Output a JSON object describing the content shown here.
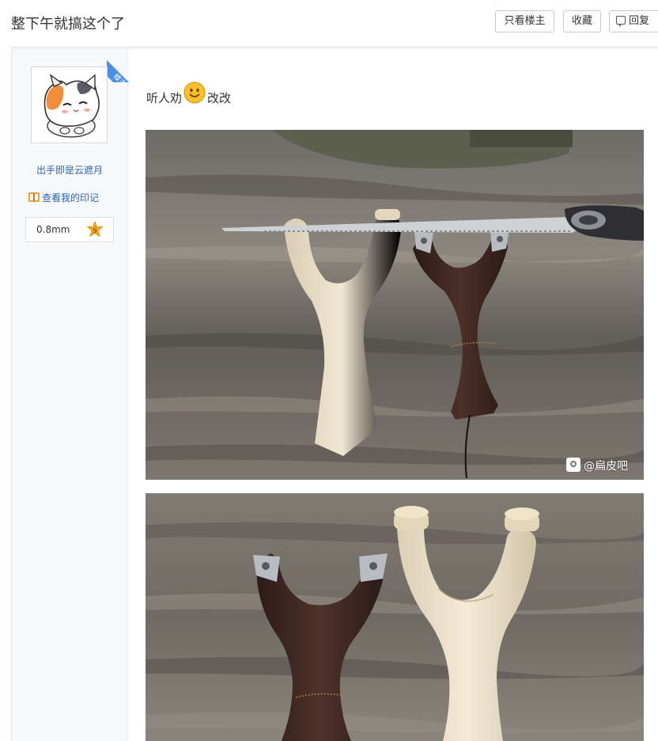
{
  "header": {
    "title": "整下午就搞这个了",
    "buttons": {
      "only_op": "只看楼主",
      "favorite": "收藏",
      "reply": "回复"
    }
  },
  "author": {
    "badge": "楼主",
    "username": "出手即是云遮月",
    "yinji_link": "查看我的印记",
    "level_text": "0.8mm",
    "level_number": "9",
    "avatar_icon": "cat-avatar-icon"
  },
  "post": {
    "text_before": "听人劝",
    "emoji": "smile-emoji-icon",
    "text_after": "改改",
    "watermark": "@扁皮吧"
  },
  "colors": {
    "link": "#2d64b3",
    "badge_blue": "#4a90e2",
    "level_star": "#f5a623"
  }
}
